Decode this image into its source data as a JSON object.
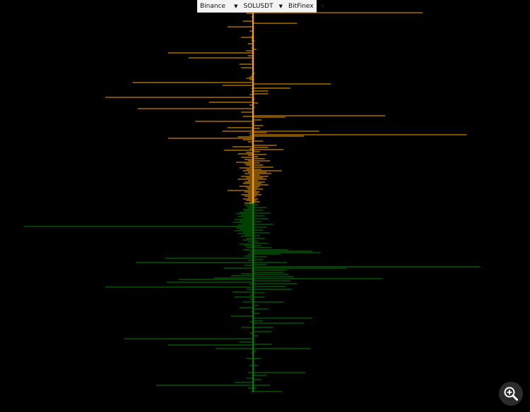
{
  "toolbar": {
    "exchange_a": "Binance",
    "symbol": "SOLUSDT",
    "exchange_b": "BitFinex"
  },
  "icons": {
    "dropdown": "caret-down-icon",
    "zoom": "zoom-in-icon"
  },
  "colors": {
    "ask": "#FFA500",
    "bid": "#008000",
    "background": "#000000"
  },
  "chart_data": {
    "type": "bar",
    "orientation": "horizontal-mirrored",
    "description_axis": "price levels top to bottom; left side = first exchange volume, right side = second exchange volume",
    "xlim": [
      -1,
      1
    ],
    "asks": {
      "left": [
        [
          1,
          0.04
        ],
        [
          6,
          0.01
        ],
        [
          12,
          0.06
        ],
        [
          20,
          0.15
        ],
        [
          26,
          0.02
        ],
        [
          33,
          0.01
        ],
        [
          35,
          0.07
        ],
        [
          37,
          0.01
        ],
        [
          40,
          0.01
        ],
        [
          44,
          0.03
        ],
        [
          50,
          0.01
        ],
        [
          54,
          0.04
        ],
        [
          57,
          0.5
        ],
        [
          61,
          0.03
        ],
        [
          64,
          0.38
        ],
        [
          69,
          0.01
        ],
        [
          73,
          0.08
        ],
        [
          78,
          0.07
        ],
        [
          88,
          0.01
        ],
        [
          91,
          0.02
        ],
        [
          93,
          0.04
        ],
        [
          95,
          0.02
        ],
        [
          99,
          0.71
        ],
        [
          103,
          0.18
        ],
        [
          107,
          0.01
        ],
        [
          112,
          0.01
        ],
        [
          116,
          0.02
        ],
        [
          120,
          0.87
        ],
        [
          124,
          0.01
        ],
        [
          127,
          0.26
        ],
        [
          131,
          0.02
        ],
        [
          136,
          0.68
        ],
        [
          141,
          0.07
        ],
        [
          147,
          0.06
        ],
        [
          154,
          0.34
        ],
        [
          158,
          0.01
        ],
        [
          163,
          0.15
        ],
        [
          166,
          0.01
        ],
        [
          168,
          0.18
        ],
        [
          171,
          0.02
        ],
        [
          174,
          0.02
        ],
        [
          176,
          0.09
        ],
        [
          178,
          0.5
        ],
        [
          180,
          0.06
        ],
        [
          183,
          0.03
        ],
        [
          186,
          0.01
        ],
        [
          190,
          0.12
        ],
        [
          193,
          0.02
        ],
        [
          195,
          0.17
        ],
        [
          198,
          0.04
        ],
        [
          200,
          0.09
        ],
        [
          202,
          0.03
        ],
        [
          205,
          0.07
        ],
        [
          208,
          0.05
        ],
        [
          210,
          0.03
        ],
        [
          212,
          0.1
        ],
        [
          214,
          0.05
        ],
        [
          216,
          0.04
        ],
        [
          218,
          0.02
        ],
        [
          220,
          0.08
        ],
        [
          222,
          0.04
        ],
        [
          224,
          0.06
        ],
        [
          226,
          0.03
        ],
        [
          228,
          0.05
        ],
        [
          230,
          0.02
        ],
        [
          232,
          0.07
        ],
        [
          234,
          0.04
        ],
        [
          236,
          0.09
        ],
        [
          238,
          0.03
        ],
        [
          240,
          0.05
        ],
        [
          242,
          0.06
        ],
        [
          244,
          0.02
        ],
        [
          246,
          0.08
        ],
        [
          248,
          0.04
        ],
        [
          250,
          0.03
        ],
        [
          252,
          0.15
        ],
        [
          254,
          0.05
        ],
        [
          256,
          0.03
        ],
        [
          258,
          0.07
        ],
        [
          260,
          0.05
        ],
        [
          262,
          0.03
        ],
        [
          264,
          0.06
        ],
        [
          266,
          0.04
        ],
        [
          268,
          0.02
        ],
        [
          270,
          0.05
        ]
      ],
      "right": [
        [
          0,
          1.0
        ],
        [
          15,
          0.26
        ],
        [
          40,
          0.01
        ],
        [
          52,
          0.02
        ],
        [
          86,
          0.01
        ],
        [
          101,
          0.46
        ],
        [
          107,
          0.22
        ],
        [
          111,
          0.09
        ],
        [
          115,
          0.09
        ],
        [
          122,
          0.01
        ],
        [
          128,
          0.03
        ],
        [
          134,
          0.01
        ],
        [
          146,
          0.78
        ],
        [
          148,
          0.19
        ],
        [
          152,
          0.05
        ],
        [
          156,
          0.01
        ],
        [
          160,
          0.06
        ],
        [
          164,
          0.04
        ],
        [
          168,
          0.39
        ],
        [
          170,
          0.08
        ],
        [
          173,
          1.26
        ],
        [
          175,
          0.3
        ],
        [
          178,
          0.01
        ],
        [
          182,
          0.06
        ],
        [
          188,
          0.14
        ],
        [
          191,
          0.09
        ],
        [
          194,
          0.18
        ],
        [
          197,
          0.04
        ],
        [
          201,
          0.08
        ],
        [
          204,
          0.03
        ],
        [
          207,
          0.07
        ],
        [
          210,
          0.1
        ],
        [
          213,
          0.04
        ],
        [
          216,
          0.06
        ],
        [
          219,
          0.12
        ],
        [
          222,
          0.05
        ],
        [
          224,
          0.17
        ],
        [
          226,
          0.08
        ],
        [
          228,
          0.11
        ],
        [
          230,
          0.04
        ],
        [
          232,
          0.09
        ],
        [
          234,
          0.06
        ],
        [
          236,
          0.08
        ],
        [
          238,
          0.03
        ],
        [
          240,
          0.07
        ],
        [
          242,
          0.05
        ],
        [
          244,
          0.09
        ],
        [
          246,
          0.04
        ],
        [
          248,
          0.03
        ],
        [
          250,
          0.06
        ],
        [
          252,
          0.02
        ],
        [
          254,
          0.04
        ],
        [
          256,
          0.03
        ],
        [
          258,
          0.05
        ],
        [
          260,
          0.02
        ],
        [
          262,
          0.01
        ],
        [
          264,
          0.03
        ],
        [
          266,
          0.02
        ],
        [
          268,
          0.04
        ],
        [
          270,
          0.01
        ]
      ]
    },
    "bids": {
      "left": [
        [
          271,
          0.02
        ],
        [
          273,
          0.05
        ],
        [
          275,
          0.04
        ],
        [
          277,
          0.03
        ],
        [
          279,
          0.06
        ],
        [
          281,
          0.05
        ],
        [
          283,
          0.08
        ],
        [
          285,
          0.1
        ],
        [
          287,
          0.07
        ],
        [
          289,
          0.09
        ],
        [
          291,
          0.06
        ],
        [
          293,
          0.11
        ],
        [
          295,
          0.08
        ],
        [
          297,
          0.12
        ],
        [
          299,
          0.07
        ],
        [
          301,
          0.09
        ],
        [
          303,
          1.35
        ],
        [
          305,
          0.1
        ],
        [
          307,
          0.08
        ],
        [
          309,
          0.11
        ],
        [
          311,
          0.06
        ],
        [
          313,
          0.09
        ],
        [
          315,
          0.05
        ],
        [
          317,
          0.07
        ],
        [
          320,
          0.04
        ],
        [
          322,
          0.06
        ],
        [
          325,
          0.03
        ],
        [
          328,
          0.08
        ],
        [
          330,
          0.05
        ],
        [
          333,
          0.04
        ],
        [
          336,
          0.06
        ],
        [
          339,
          0.02
        ],
        [
          342,
          0.03
        ],
        [
          345,
          0.05
        ],
        [
          348,
          0.52
        ],
        [
          351,
          0.03
        ],
        [
          354,
          0.69
        ],
        [
          358,
          0.05
        ],
        [
          362,
          0.17
        ],
        [
          366,
          0.01
        ],
        [
          370,
          0.07
        ],
        [
          373,
          0.13
        ],
        [
          376,
          0.23
        ],
        [
          378,
          0.44
        ],
        [
          382,
          0.51
        ],
        [
          385,
          0.02
        ],
        [
          389,
          0.87
        ],
        [
          392,
          0.04
        ],
        [
          396,
          0.12
        ],
        [
          400,
          0.02
        ],
        [
          403,
          0.11
        ],
        [
          406,
          0.02
        ],
        [
          410,
          0.06
        ],
        [
          418,
          0.08
        ],
        [
          424,
          0.01
        ],
        [
          430,
          0.13
        ],
        [
          438,
          0.02
        ],
        [
          446,
          0.07
        ],
        [
          454,
          0.02
        ],
        [
          462,
          0.76
        ],
        [
          467,
          0.08
        ],
        [
          471,
          0.5
        ],
        [
          476,
          0.22
        ],
        [
          482,
          0.01
        ],
        [
          490,
          0.04
        ],
        [
          500,
          0.02
        ],
        [
          510,
          0.03
        ],
        [
          518,
          0.04
        ],
        [
          524,
          0.11
        ],
        [
          528,
          0.57
        ],
        [
          532,
          0.03
        ],
        [
          536,
          0.01
        ]
      ],
      "right": [
        [
          272,
          0.03
        ],
        [
          276,
          0.08
        ],
        [
          280,
          0.06
        ],
        [
          284,
          0.1
        ],
        [
          288,
          0.07
        ],
        [
          292,
          0.09
        ],
        [
          296,
          0.05
        ],
        [
          300,
          0.12
        ],
        [
          304,
          0.08
        ],
        [
          308,
          0.06
        ],
        [
          312,
          0.1
        ],
        [
          316,
          0.04
        ],
        [
          320,
          0.07
        ],
        [
          324,
          0.03
        ],
        [
          327,
          0.09
        ],
        [
          330,
          0.05
        ],
        [
          333,
          0.11
        ],
        [
          336,
          0.21
        ],
        [
          338,
          0.35
        ],
        [
          340,
          0.4
        ],
        [
          342,
          0.16
        ],
        [
          346,
          0.08
        ],
        [
          350,
          0.06
        ],
        [
          354,
          0.2
        ],
        [
          357,
          0.08
        ],
        [
          360,
          1.34
        ],
        [
          362,
          0.55
        ],
        [
          365,
          0.2
        ],
        [
          368,
          0.18
        ],
        [
          371,
          0.21
        ],
        [
          374,
          0.24
        ],
        [
          377,
          0.76
        ],
        [
          380,
          0.22
        ],
        [
          384,
          0.26
        ],
        [
          388,
          0.19
        ],
        [
          392,
          0.23
        ],
        [
          397,
          0.07
        ],
        [
          403,
          0.07
        ],
        [
          410,
          0.18
        ],
        [
          415,
          0.03
        ],
        [
          420,
          0.09
        ],
        [
          426,
          0.04
        ],
        [
          433,
          0.35
        ],
        [
          437,
          0.06
        ],
        [
          440,
          0.3
        ],
        [
          446,
          0.12
        ],
        [
          452,
          0.11
        ],
        [
          458,
          0.03
        ],
        [
          470,
          0.11
        ],
        [
          476,
          0.34
        ],
        [
          480,
          0.02
        ],
        [
          490,
          0.05
        ],
        [
          500,
          0.03
        ],
        [
          510,
          0.31
        ],
        [
          514,
          0.08
        ],
        [
          520,
          0.05
        ],
        [
          528,
          0.1
        ],
        [
          532,
          0.02
        ],
        [
          537,
          0.17
        ]
      ]
    }
  }
}
